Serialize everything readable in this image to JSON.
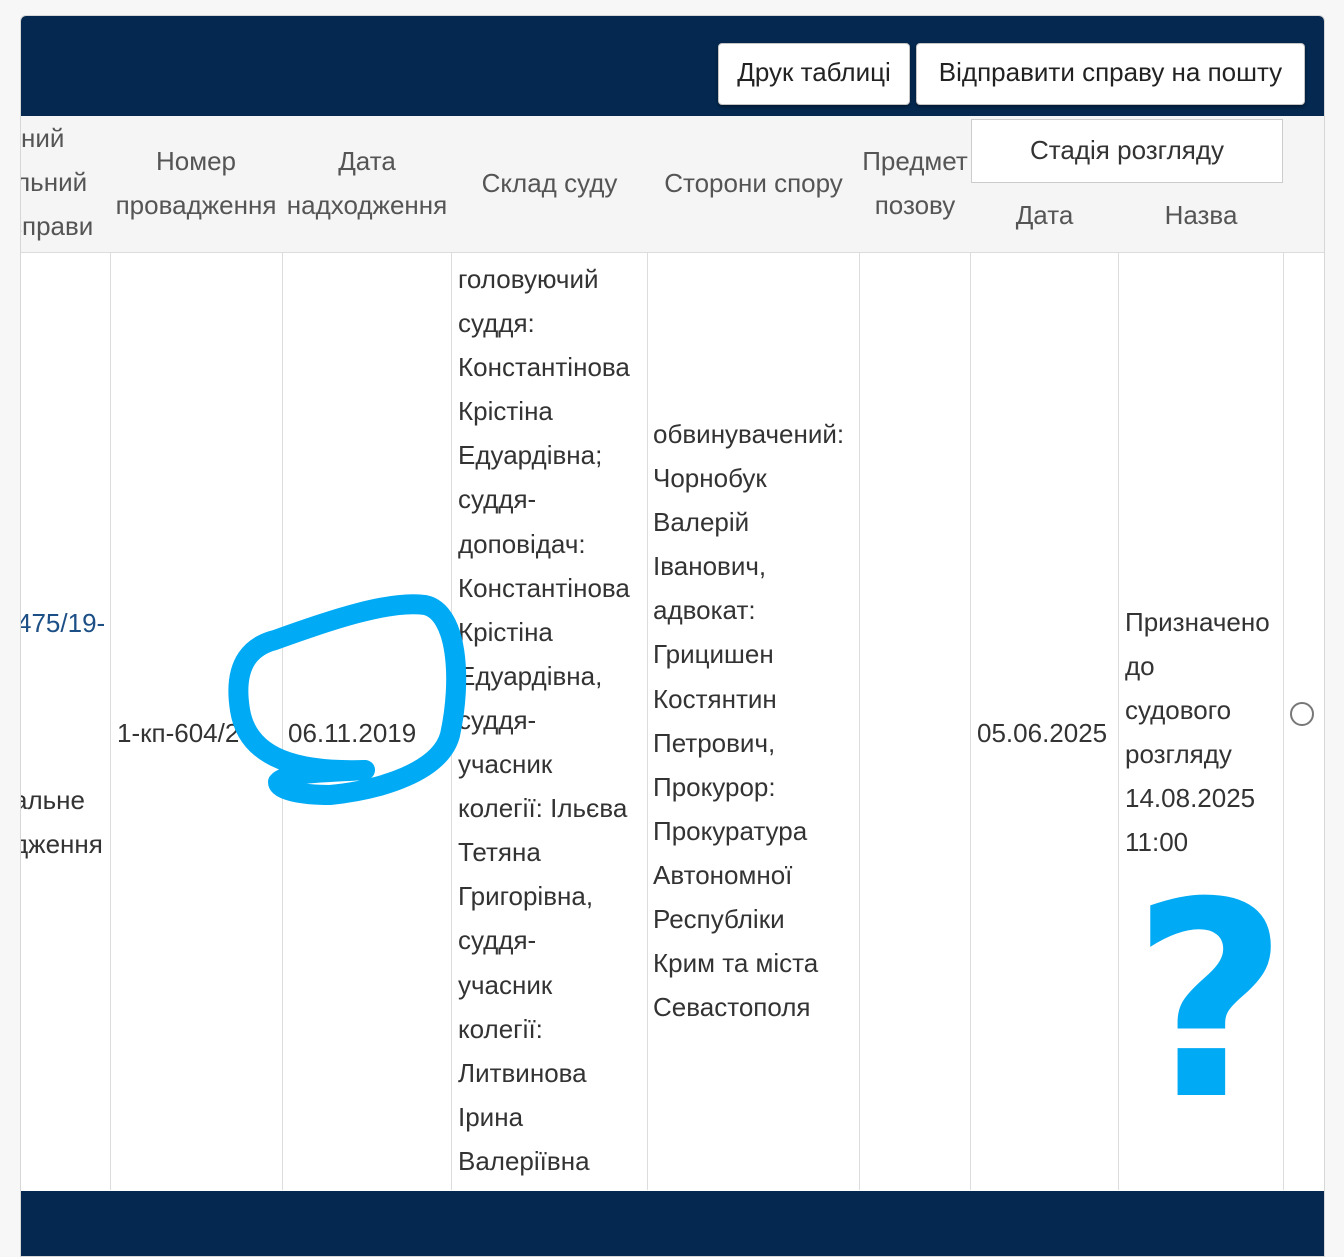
{
  "toolbar": {
    "print_label": "Друк таблиці",
    "email_label": "Відправити справу на пошту"
  },
  "table": {
    "headers": {
      "case_number_lines": [
        "ний",
        "льний",
        "справи"
      ],
      "proceeding_number_lines": [
        "Номер",
        "провадження"
      ],
      "receipt_date_lines": [
        "Дата",
        "надходження"
      ],
      "court_composition": "Склад суду",
      "parties": "Сторони спору",
      "subject_lines": [
        "Предмет",
        "позову"
      ],
      "stage": "Стадія розгляду",
      "stage_date": "Дата",
      "stage_name": "Назва"
    },
    "row": {
      "case_number_link": "475/19-",
      "case_category_lines": [
        "альне",
        "дження"
      ],
      "proceeding_number": "1-кп-604/25",
      "receipt_date": "06.11.2019",
      "court_composition_lines": [
        "головуючий",
        "суддя:",
        "Константінова",
        "Крістіна",
        "Едуардівна;",
        "суддя-",
        "доповідач:",
        "Константінова",
        "Крістіна",
        "Едуардівна,",
        "суддя-",
        "учасник",
        "колегії: Ільєва",
        "Тетяна",
        "Григорівна,",
        "суддя-",
        "учасник",
        "колегії:",
        "Литвинова",
        "Ірина",
        "Валеріївна"
      ],
      "parties_lines": [
        "обвинувачений:",
        "Чорнобук",
        "Валерій",
        "Іванович,",
        "адвокат:",
        "Грицишен",
        "Костянтин",
        "Петрович,",
        "Прокурор:",
        "Прокуратура",
        "Автономної",
        "Республіки",
        "Крим та міста",
        "Севастополя"
      ],
      "subject": "",
      "stage_date": "05.06.2025",
      "stage_name_lines": [
        "Призначено",
        "до",
        "судового",
        "розгляду",
        "14.08.2025",
        "11:00"
      ]
    }
  },
  "annotations": {
    "question_mark": "?"
  },
  "colors": {
    "navy_bar": "#04284f",
    "link": "#1c4f86",
    "scribble": "#00aaf5"
  }
}
